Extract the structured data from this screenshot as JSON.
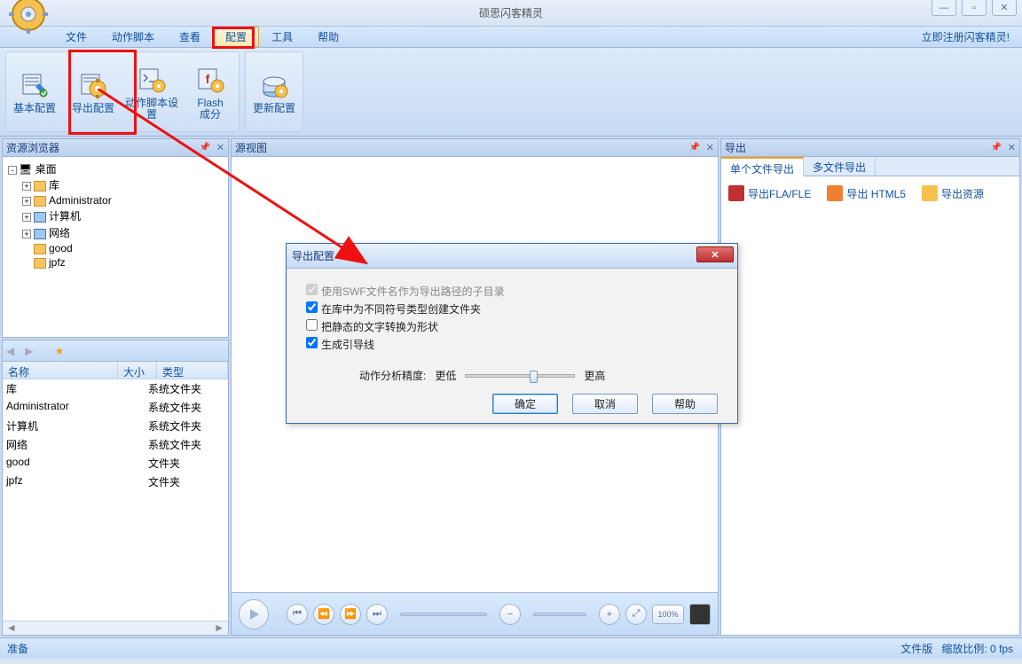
{
  "window": {
    "title": "硕思闪客精灵"
  },
  "menu": {
    "items": [
      "文件",
      "动作脚本",
      "查看",
      "配置",
      "工具",
      "帮助"
    ],
    "active_index": 3,
    "register_link": "立即注册闪客精灵!"
  },
  "ribbon": {
    "buttons": [
      {
        "label": "基本配置",
        "icon": "basic"
      },
      {
        "label": "导出配置",
        "icon": "export"
      },
      {
        "label": "动作脚本设置",
        "icon": "script"
      },
      {
        "label": "Flash\n成分",
        "icon": "flash"
      },
      {
        "label": "更新配置",
        "icon": "update"
      }
    ]
  },
  "leftpanel": {
    "title": "资源浏览器",
    "tree": {
      "root": "桌面",
      "children": [
        {
          "label": "库",
          "expand": "+"
        },
        {
          "label": "Administrator",
          "expand": "+"
        },
        {
          "label": "计算机",
          "expand": "+"
        },
        {
          "label": "网络",
          "expand": "+"
        },
        {
          "label": "good",
          "expand": ""
        },
        {
          "label": "jpfz",
          "expand": ""
        }
      ]
    },
    "filehdr": {
      "name": "名称",
      "size": "大小",
      "type": "类型"
    },
    "files": [
      {
        "name": "库",
        "type": "系统文件夹"
      },
      {
        "name": "Administrator",
        "type": "系统文件夹"
      },
      {
        "name": "计算机",
        "type": "系统文件夹"
      },
      {
        "name": "网络",
        "type": "系统文件夹"
      },
      {
        "name": "good",
        "type": "文件夹"
      },
      {
        "name": "jpfz",
        "type": "文件夹"
      }
    ]
  },
  "centerpanel": {
    "title": "源视图"
  },
  "rightpanel": {
    "title": "导出",
    "tabs": [
      "单个文件导出",
      "多文件导出"
    ],
    "active_tab": 0,
    "items": [
      {
        "label": "导出FLA/FLE",
        "icon": "fla"
      },
      {
        "label": "导出 HTML5",
        "icon": "html5"
      },
      {
        "label": "导出资源",
        "icon": "res"
      }
    ]
  },
  "dialog": {
    "title": "导出配置",
    "checks": [
      {
        "label": "使用SWF文件名作为导出路径的子目录",
        "checked": true,
        "disabled": true
      },
      {
        "label": "在库中为不同符号类型创建文件夹",
        "checked": true,
        "disabled": false
      },
      {
        "label": "把静态的文字转换为形状",
        "checked": false,
        "disabled": false
      },
      {
        "label": "生成引导线",
        "checked": true,
        "disabled": false
      }
    ],
    "slider": {
      "label": "动作分析精度:",
      "low": "更低",
      "high": "更高"
    },
    "buttons": {
      "ok": "确定",
      "cancel": "取消",
      "help": "帮助"
    }
  },
  "status": {
    "left": "准备",
    "right1": "文件版",
    "right2": "缩放比例: 0 fps"
  },
  "zoom_label": "100%"
}
